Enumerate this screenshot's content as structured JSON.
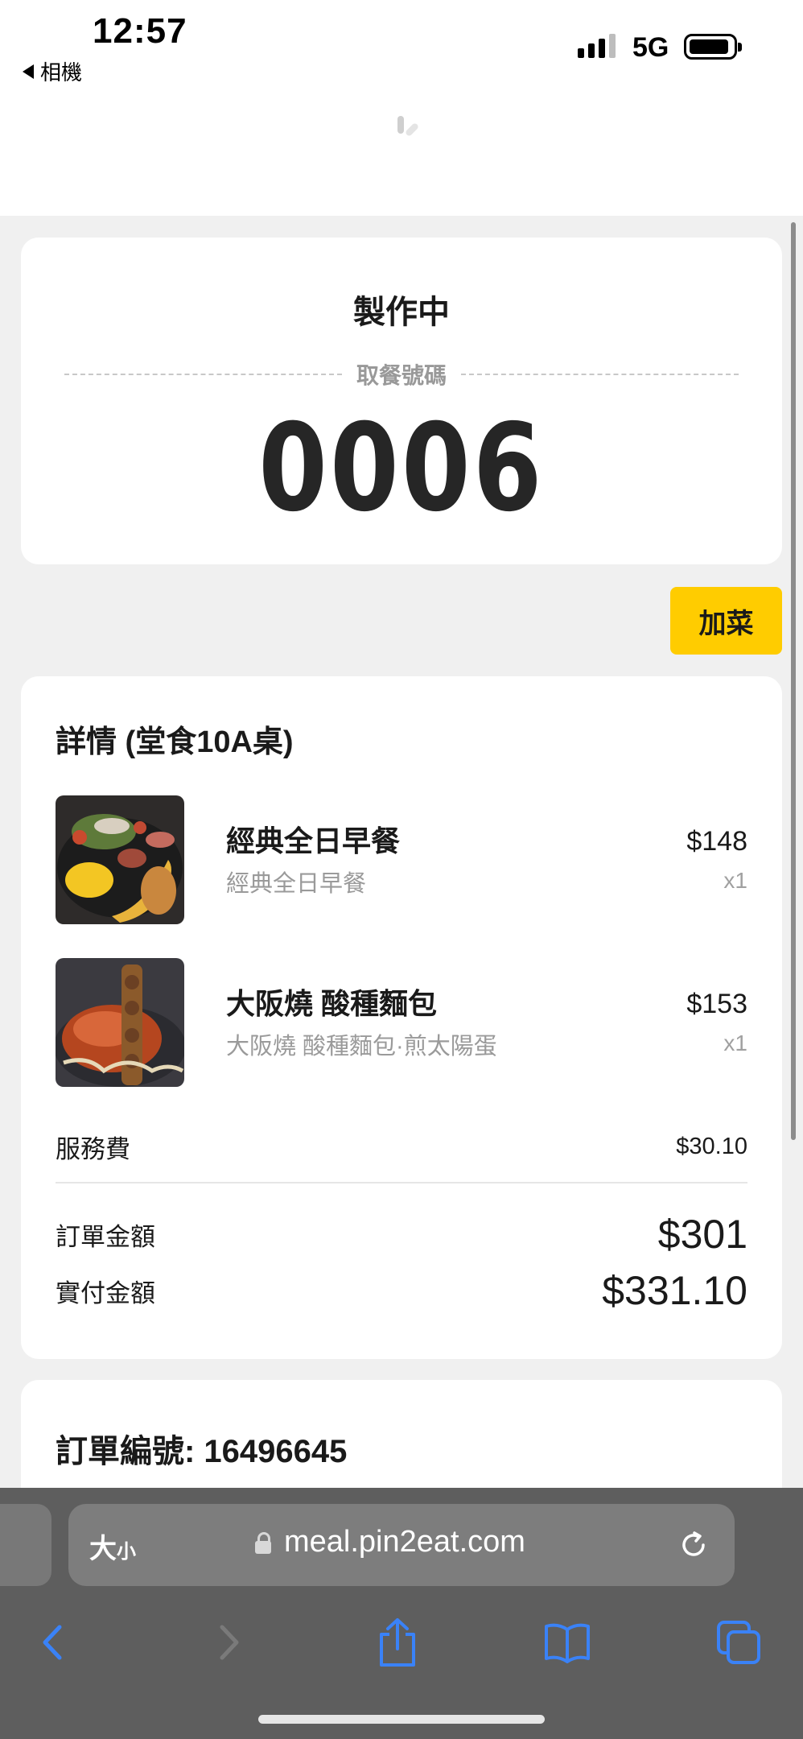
{
  "status_bar": {
    "time": "12:57",
    "back_app": "相機",
    "network": "5G"
  },
  "order_status": {
    "title": "製作中",
    "pickup_label": "取餐號碼",
    "pickup_number": "0006"
  },
  "add_button_label": "加菜",
  "details": {
    "title": "詳情 (堂食10A桌)",
    "items": [
      {
        "name": "經典全日早餐",
        "sub": "經典全日早餐",
        "price": "$148",
        "qty": "x1",
        "image": "breakfast-platter-photo"
      },
      {
        "name": "大阪燒 酸種麵包",
        "sub": "大阪燒 酸種麵包·煎太陽蛋",
        "price": "$153",
        "qty": "x1",
        "image": "okonomiyaki-photo"
      }
    ],
    "service_fee_label": "服務費",
    "service_fee": "$30.10",
    "order_amount_label": "訂單金額",
    "order_amount": "$301",
    "paid_amount_label": "實付金額",
    "paid_amount": "$331.10"
  },
  "order_info": {
    "order_number_label": "訂單編號: 16496645"
  },
  "browser": {
    "text_size_big": "大",
    "text_size_small": "小",
    "url": "meal.pin2eat.com"
  },
  "colors": {
    "accent_button": "#ffcc00",
    "ios_blue": "#3a82f7",
    "page_bg": "#f0f0f0"
  }
}
